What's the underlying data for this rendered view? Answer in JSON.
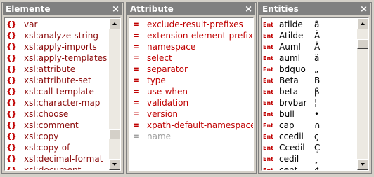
{
  "elements_panel": {
    "title": "Elemente",
    "close": "×",
    "icon_glyph": "{}",
    "items": [
      "var",
      "xsl:analyze-string",
      "xsl:apply-imports",
      "xsl:apply-templates",
      "xsl:attribute",
      "xsl:attribute-set",
      "xsl:call-template",
      "xsl:character-map",
      "xsl:choose",
      "xsl:comment",
      "xsl:copy",
      "xsl:copy-of",
      "xsl:decimal-format",
      "xsl:document"
    ]
  },
  "attributes_panel": {
    "title": "Attribute",
    "close": "×",
    "icon_glyph": "=",
    "items": [
      {
        "label": "exclude-result-prefixes",
        "enabled": true
      },
      {
        "label": "extension-element-prefixes",
        "enabled": true
      },
      {
        "label": "namespace",
        "enabled": true
      },
      {
        "label": "select",
        "enabled": true
      },
      {
        "label": "separator",
        "enabled": true
      },
      {
        "label": "type",
        "enabled": true
      },
      {
        "label": "use-when",
        "enabled": true
      },
      {
        "label": "validation",
        "enabled": true
      },
      {
        "label": "version",
        "enabled": true
      },
      {
        "label": "xpath-default-namespace",
        "enabled": true
      },
      {
        "label": "name",
        "enabled": false
      }
    ]
  },
  "entities_panel": {
    "title": "Entities",
    "close": "×",
    "icon_label": "Ent",
    "items": [
      {
        "name": "atilde",
        "char": "ã"
      },
      {
        "name": "Atilde",
        "char": "Ã"
      },
      {
        "name": "Auml",
        "char": "Ä"
      },
      {
        "name": "auml",
        "char": "ä"
      },
      {
        "name": "bdquo",
        "char": "„"
      },
      {
        "name": "Beta",
        "char": "Β"
      },
      {
        "name": "beta",
        "char": "β"
      },
      {
        "name": "brvbar",
        "char": "¦"
      },
      {
        "name": "bull",
        "char": "•"
      },
      {
        "name": "cap",
        "char": "∩"
      },
      {
        "name": "ccedil",
        "char": "ç"
      },
      {
        "name": "Ccedil",
        "char": "Ç"
      },
      {
        "name": "cedil",
        "char": "¸"
      },
      {
        "name": "cent",
        "char": "¢"
      }
    ]
  },
  "colors": {
    "header_bg": "#808080",
    "element_text": "#8b0a0a",
    "attribute_text": "#c00000",
    "disabled_text": "#a0a0a0"
  }
}
